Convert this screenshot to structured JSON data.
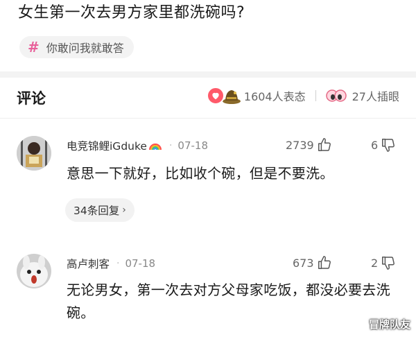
{
  "question": {
    "title": "女生第一次去男方家里都洗碗吗?",
    "topic": {
      "icon": "hash-icon",
      "label": "你敢问我就敢答"
    }
  },
  "comments_header": {
    "title": "评论",
    "reaction_count": "1604人表态",
    "view_count": "27人插眼"
  },
  "comments": [
    {
      "username": "电竞锦鲤iGduke",
      "badge_icon": "rainbow-icon",
      "date": "07-18",
      "likes": "2739",
      "dislikes": "6",
      "text": "意思一下就好，比如收个碗，但是不要洗。",
      "replies_label": "34条回复"
    },
    {
      "username": "高卢刺客",
      "date": "07-18",
      "likes": "673",
      "dislikes": "2",
      "text": "无论男女，第一次去对方父母家吃饭，都没必要去洗碗。"
    }
  ],
  "watermark": "冒牌队友",
  "colors": {
    "accent_pink": "#e8609a",
    "like_red": "#ff5a6a",
    "band_gray": "#f3f3f3"
  }
}
